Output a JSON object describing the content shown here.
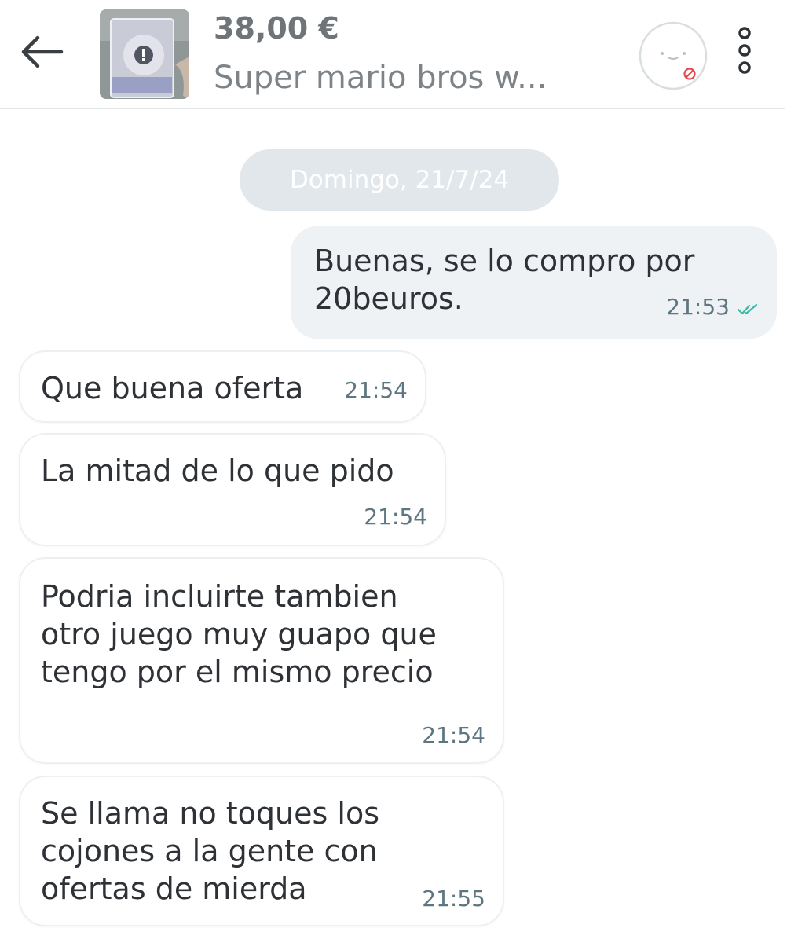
{
  "header": {
    "back_icon": "arrow-left-icon",
    "product_thumbnail": "product-photo",
    "price": "38,00 €",
    "title": "Super mario bros w...",
    "avatar_icon": "user-avatar-placeholder-icon",
    "blocked_badge_icon": "blocked-icon",
    "menu_icon": "more-vertical-icon"
  },
  "chat": {
    "date_separator": "Domingo, 21/7/24",
    "messages": [
      {
        "direction": "outgoing",
        "text": "Buenas, se lo compro por\n20beuros.",
        "time": "21:53",
        "status": "read"
      },
      {
        "direction": "incoming",
        "text": "Que buena oferta",
        "time": "21:54"
      },
      {
        "direction": "incoming",
        "text": "La mitad de lo que pido",
        "time": "21:54"
      },
      {
        "direction": "incoming",
        "text": "Podria incluirte tambien\notro juego muy guapo que\ntengo por el mismo precio",
        "time": "21:54"
      },
      {
        "direction": "incoming",
        "text": "Se llama no toques los\ncojones a la gente con\nofertas de mierda",
        "time": "21:55"
      }
    ]
  },
  "colors": {
    "outgoing_bubble": "#eef2f4",
    "incoming_bubble": "#ffffff",
    "date_pill": "#e1e7ea",
    "read_ticks": "#3fb8a6",
    "time_text": "#5d7680",
    "blocked_badge": "#e5484d"
  }
}
